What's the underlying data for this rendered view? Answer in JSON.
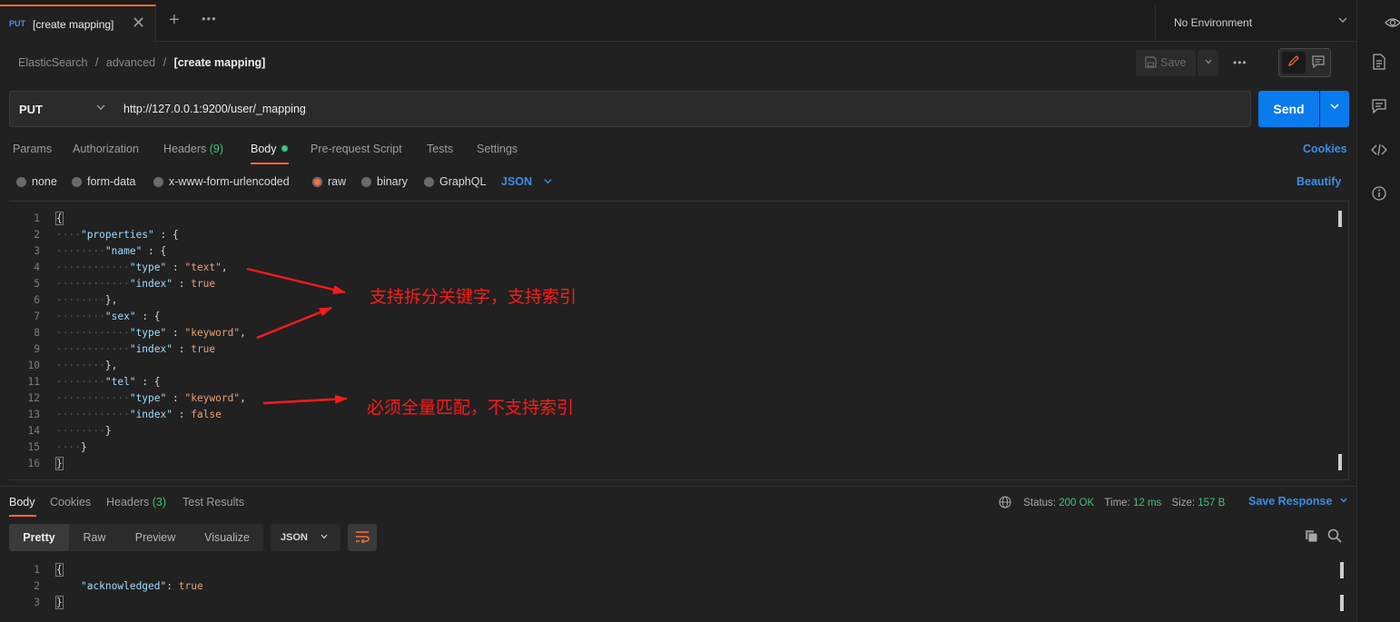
{
  "tab": {
    "method": "PUT",
    "name": "[create mapping]",
    "close": "✕",
    "add": "+",
    "more": "•••"
  },
  "environment": {
    "label": "No Environment"
  },
  "breadcrumb": {
    "part1": "ElasticSearch",
    "part2": "advanced",
    "current": "[create mapping]",
    "sep": "/"
  },
  "toolbar": {
    "save_label": "Save",
    "more": "•••"
  },
  "request": {
    "method": "PUT",
    "url": "http://127.0.0.1:9200/user/_mapping",
    "send_label": "Send"
  },
  "req_tabs": {
    "params": "Params",
    "authorization": "Authorization",
    "headers": "Headers",
    "headers_count": "(9)",
    "body": "Body",
    "prerequest": "Pre-request Script",
    "tests": "Tests",
    "settings": "Settings",
    "cookies": "Cookies"
  },
  "body_modes": {
    "none": "none",
    "form_data": "form-data",
    "urlencoded": "x-www-form-urlencoded",
    "raw": "raw",
    "binary": "binary",
    "graphql": "GraphQL",
    "format": "JSON",
    "beautify": "Beautify",
    "selected": "raw"
  },
  "editor": {
    "lines": [
      {
        "n": "1"
      },
      {
        "n": "2"
      },
      {
        "n": "3"
      },
      {
        "n": "4"
      },
      {
        "n": "5"
      },
      {
        "n": "6"
      },
      {
        "n": "7"
      },
      {
        "n": "8"
      },
      {
        "n": "9"
      },
      {
        "n": "10"
      },
      {
        "n": "11"
      },
      {
        "n": "12"
      },
      {
        "n": "13"
      },
      {
        "n": "14"
      },
      {
        "n": "15"
      },
      {
        "n": "16"
      }
    ],
    "code": {
      "properties": "\"properties\"",
      "name": "\"name\"",
      "type": "\"type\"",
      "text": "\"text\"",
      "index": "\"index\"",
      "sex": "\"sex\"",
      "keyword": "\"keyword\"",
      "tel": "\"tel\"",
      "true": "true",
      "false": "false"
    }
  },
  "annotations": {
    "first": "支持拆分关键字，支持索引",
    "second": "必须全量匹配，不支持索引"
  },
  "response": {
    "tabs": {
      "body": "Body",
      "cookies": "Cookies",
      "headers": "Headers",
      "headers_count": "(3)",
      "test_results": "Test Results"
    },
    "status_label": "Status:",
    "status": "200 OK",
    "time_label": "Time:",
    "time": "12 ms",
    "size_label": "Size:",
    "size": "157 B",
    "save_response": "Save Response",
    "views": {
      "pretty": "Pretty",
      "raw": "Raw",
      "preview": "Preview",
      "visualize": "Visualize"
    },
    "format": "JSON",
    "lines": [
      {
        "n": "1"
      },
      {
        "n": "2"
      },
      {
        "n": "3"
      }
    ],
    "code": {
      "acknowledged": "\"acknowledged\"",
      "true": "true"
    }
  },
  "colors": {
    "accent": "#ff6c37",
    "primary": "#097bed",
    "link": "#3d8de6",
    "success": "#3ec47a",
    "annotation": "#ff1a1a"
  }
}
